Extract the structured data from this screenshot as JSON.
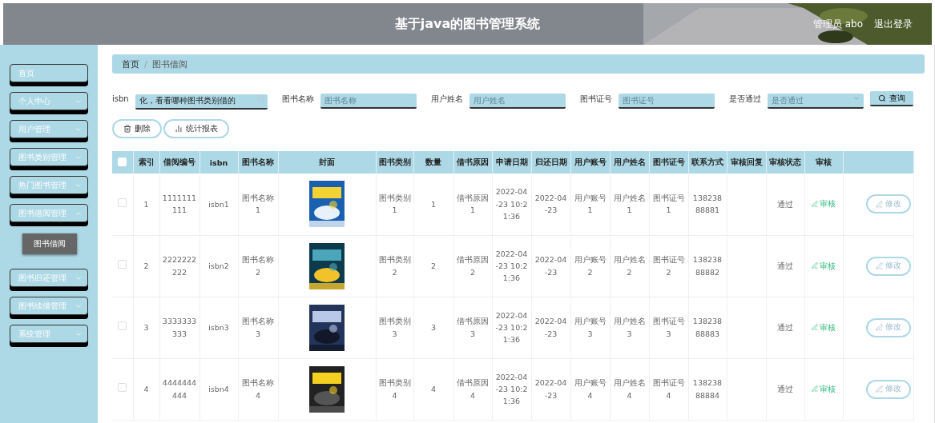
{
  "header": {
    "title": "基于java的图书管理系统",
    "user": "管理员 abo",
    "logout": "退出登录"
  },
  "sidebar": {
    "items": [
      {
        "label": "首页",
        "kind": "link"
      },
      {
        "label": "个人中心",
        "kind": "submenu",
        "expanded": false
      },
      {
        "label": "用户管理",
        "kind": "submenu",
        "expanded": false
      },
      {
        "label": "图书类别管理",
        "kind": "submenu",
        "expanded": false
      },
      {
        "label": "热门图书管理",
        "kind": "submenu",
        "expanded": false
      },
      {
        "label": "图书借阅管理",
        "kind": "submenu",
        "expanded": true,
        "children": [
          {
            "label": "图书借阅",
            "selected": true
          }
        ]
      },
      {
        "label": "图书归还管理",
        "kind": "submenu",
        "expanded": false
      },
      {
        "label": "图书续借管理",
        "kind": "submenu",
        "expanded": false
      },
      {
        "label": "系统管理",
        "kind": "submenu",
        "expanded": false
      }
    ]
  },
  "breadcrumb": {
    "items": [
      "首页",
      "图书借阅"
    ],
    "separator": "/"
  },
  "search": {
    "fields": [
      {
        "label": "isbn",
        "kind": "input",
        "value": "化，看看哪种图书类别借的"
      },
      {
        "label": "图书名称",
        "kind": "input",
        "placeholder": "图书名称"
      },
      {
        "label": "用户姓名",
        "kind": "input",
        "placeholder": "用户姓名"
      },
      {
        "label": "图书证号",
        "kind": "input",
        "placeholder": "图书证号"
      },
      {
        "label": "是否通过",
        "kind": "select",
        "placeholder": "是否通过"
      }
    ],
    "button": "查询"
  },
  "actions": [
    {
      "label": "删除",
      "kind": "delete"
    },
    {
      "label": "统计报表",
      "kind": "chart"
    }
  ],
  "table": {
    "columns": [
      "索引",
      "借阅编号",
      "isbn",
      "图书名称",
      "封面",
      "图书类别",
      "数量",
      "借书原因",
      "申请日期",
      "归还日期",
      "用户账号",
      "用户姓名",
      "图书证号",
      "联系方式",
      "审核回复",
      "审核状态",
      "审核"
    ],
    "header_checked": false,
    "rows": [
      {
        "checked": false,
        "index": "1",
        "borrow_no": "1111111111",
        "isbn": "isbn1",
        "book_name": "图书名称1",
        "category": "图书类别1",
        "quantity": "1",
        "reason": "借书原因1",
        "apply_date": "2022-04-23 10:21:36",
        "return_date": "2022-04-23",
        "account": "用户账号1",
        "user_name": "用户姓名1",
        "card_no": "图书证号1",
        "phone": "13823888881",
        "status": "通过",
        "review": "审核",
        "edit": "修改"
      },
      {
        "checked": false,
        "index": "2",
        "borrow_no": "2222222222",
        "isbn": "isbn2",
        "book_name": "图书名称2",
        "category": "图书类别2",
        "quantity": "2",
        "reason": "借书原因2",
        "apply_date": "2022-04-23 10:21:36",
        "return_date": "2022-04-23",
        "account": "用户账号2",
        "user_name": "用户姓名2",
        "card_no": "图书证号2",
        "phone": "13823888882",
        "status": "通过",
        "review": "审核",
        "edit": "修改"
      },
      {
        "checked": false,
        "index": "3",
        "borrow_no": "3333333333",
        "isbn": "isbn3",
        "book_name": "图书名称3",
        "category": "图书类别3",
        "quantity": "3",
        "reason": "借书原因3",
        "apply_date": "2022-04-23 10:21:36",
        "return_date": "2022-04-23",
        "account": "用户账号3",
        "user_name": "用户姓名3",
        "card_no": "图书证号3",
        "phone": "13823888883",
        "status": "通过",
        "review": "审核",
        "edit": "修改"
      },
      {
        "checked": false,
        "index": "4",
        "borrow_no": "4444444444",
        "isbn": "isbn4",
        "book_name": "图书名称4",
        "category": "图书类别4",
        "quantity": "4",
        "reason": "借书原因4",
        "apply_date": "2022-04-23 10:21:36",
        "return_date": "2022-04-23",
        "account": "用户账号4",
        "user_name": "用户姓名4",
        "card_no": "图书证号4",
        "phone": "13823888884",
        "status": "通过",
        "review": "审核",
        "edit": "修改"
      }
    ]
  }
}
